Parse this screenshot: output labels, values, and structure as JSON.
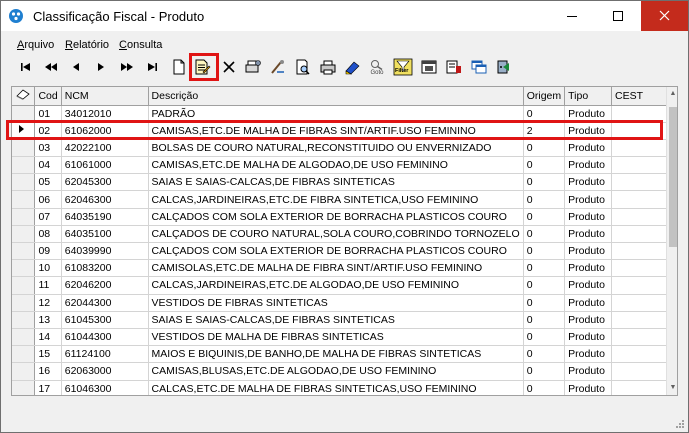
{
  "window": {
    "title": "Classificação Fiscal - Produto"
  },
  "menu": [
    {
      "label": "Arquivo",
      "underline": "A"
    },
    {
      "label": "Relatório",
      "underline": "R"
    },
    {
      "label": "Consulta",
      "underline": "C"
    }
  ],
  "toolbar": {
    "icons": [
      "first-icon",
      "prior-page-icon",
      "prior-icon",
      "next-icon",
      "next-page-icon",
      "last-icon",
      "new-icon",
      "edit-icon",
      "delete-icon",
      "print-setup-icon",
      "tools-icon",
      "preview-icon",
      "print-icon",
      "export-icon",
      "goto-icon",
      "filter-icon",
      "window-icon",
      "report-icon",
      "cascade-icon",
      "exit-icon"
    ],
    "goto_label": "Goto",
    "filter_label": "Filter"
  },
  "grid": {
    "columns": [
      "",
      "Cod",
      "NCM",
      "Descrição",
      "Origem",
      "Tipo",
      "CEST"
    ],
    "rows": [
      {
        "cod": "01",
        "ncm": "34012010",
        "desc": "PADRÃO",
        "origem": "0",
        "tipo": "Produto",
        "cest": ""
      },
      {
        "cod": "02",
        "ncm": "61062000",
        "desc": "CAMISAS,ETC.DE MALHA DE FIBRAS SINT/ARTIF.USO FEMININO",
        "origem": "2",
        "tipo": "Produto",
        "cest": "",
        "selected": true
      },
      {
        "cod": "03",
        "ncm": "42022100",
        "desc": "BOLSAS DE COURO NATURAL,RECONSTITUIDO OU ENVERNIZADO",
        "origem": "0",
        "tipo": "Produto",
        "cest": ""
      },
      {
        "cod": "04",
        "ncm": "61061000",
        "desc": "CAMISAS,ETC.DE MALHA DE ALGODAO,DE USO FEMININO",
        "origem": "0",
        "tipo": "Produto",
        "cest": ""
      },
      {
        "cod": "05",
        "ncm": "62045300",
        "desc": "SAIAS E SAIAS-CALCAS,DE FIBRAS SINTETICAS",
        "origem": "0",
        "tipo": "Produto",
        "cest": ""
      },
      {
        "cod": "06",
        "ncm": "62046300",
        "desc": "CALCAS,JARDINEIRAS,ETC.DE FIBRA SINTETICA,USO FEMININO",
        "origem": "0",
        "tipo": "Produto",
        "cest": ""
      },
      {
        "cod": "07",
        "ncm": "64035190",
        "desc": "CALÇADOS COM SOLA EXTERIOR DE BORRACHA PLASTICOS COURO",
        "origem": "0",
        "tipo": "Produto",
        "cest": ""
      },
      {
        "cod": "08",
        "ncm": "64035100",
        "desc": "CALÇADOS DE COURO NATURAL,SOLA COURO,COBRINDO TORNOZELO",
        "origem": "0",
        "tipo": "Produto",
        "cest": ""
      },
      {
        "cod": "09",
        "ncm": "64039990",
        "desc": "CALÇADOS COM SOLA EXTERIOR DE BORRACHA PLASTICOS COURO",
        "origem": "0",
        "tipo": "Produto",
        "cest": ""
      },
      {
        "cod": "10",
        "ncm": "61083200",
        "desc": "CAMISOLAS,ETC.DE MALHA DE FIBRA SINT/ARTIF.USO FEMININO",
        "origem": "0",
        "tipo": "Produto",
        "cest": ""
      },
      {
        "cod": "11",
        "ncm": "62046200",
        "desc": "CALCAS,JARDINEIRAS,ETC.DE ALGODAO,DE USO FEMININO",
        "origem": "0",
        "tipo": "Produto",
        "cest": ""
      },
      {
        "cod": "12",
        "ncm": "62044300",
        "desc": "VESTIDOS DE FIBRAS SINTETICAS",
        "origem": "0",
        "tipo": "Produto",
        "cest": ""
      },
      {
        "cod": "13",
        "ncm": "61045300",
        "desc": "SAIAS E SAIAS-CALCAS,DE FIBRAS SINTETICAS",
        "origem": "0",
        "tipo": "Produto",
        "cest": ""
      },
      {
        "cod": "14",
        "ncm": "61044300",
        "desc": "VESTIDOS DE MALHA DE FIBRAS SINTETICAS",
        "origem": "0",
        "tipo": "Produto",
        "cest": ""
      },
      {
        "cod": "15",
        "ncm": "61124100",
        "desc": "MAIOS E BIQUINIS,DE BANHO,DE MALHA DE FIBRAS SINTETICAS",
        "origem": "0",
        "tipo": "Produto",
        "cest": ""
      },
      {
        "cod": "16",
        "ncm": "62063000",
        "desc": "CAMISAS,BLUSAS,ETC.DE ALGODAO,DE USO FEMININO",
        "origem": "0",
        "tipo": "Produto",
        "cest": ""
      },
      {
        "cod": "17",
        "ncm": "61046300",
        "desc": "CALCAS,ETC.DE MALHA DE FIBRAS SINTETICAS,USO FEMININO",
        "origem": "0",
        "tipo": "Produto",
        "cest": ""
      }
    ]
  },
  "colors": {
    "highlight": "#e01414",
    "close_button": "#c42b1c"
  }
}
